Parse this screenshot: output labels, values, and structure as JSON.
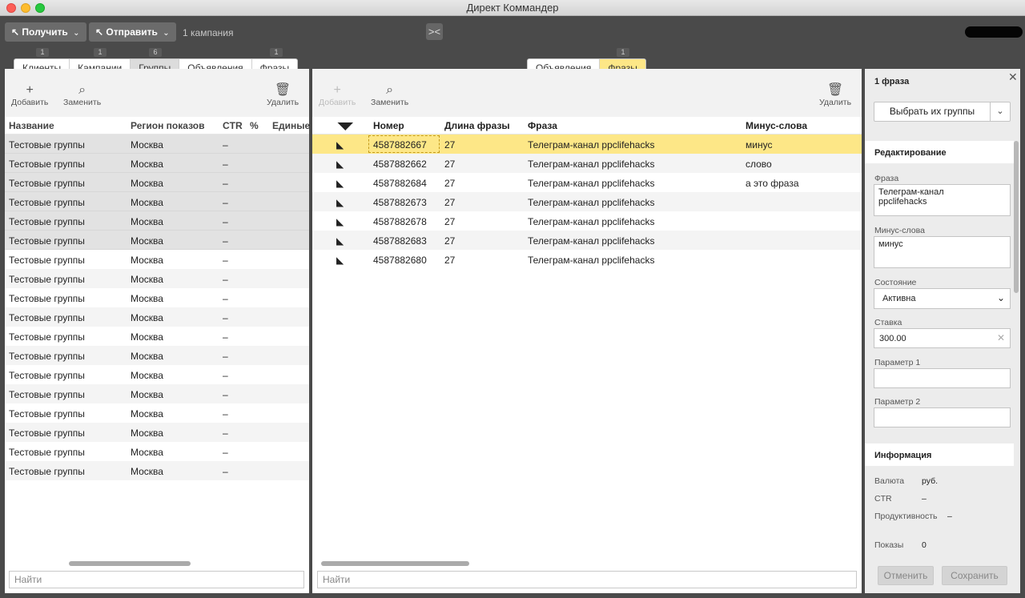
{
  "window": {
    "title": "Директ Коммандер"
  },
  "toolbar": {
    "get_label": "Получить",
    "send_label": "Отправить",
    "campaign_count": "1 кампания",
    "swap_symbol": "><"
  },
  "left": {
    "tabs": [
      {
        "label": "Клиенты",
        "count": "1"
      },
      {
        "label": "Кампании",
        "count": "1"
      },
      {
        "label": "Группы",
        "count": "6"
      },
      {
        "label": "Объявления",
        "count": ""
      },
      {
        "label": "Фразы",
        "count": "1"
      }
    ],
    "actions": {
      "add": "Добавить",
      "replace": "Заменить",
      "delete": "Удалить"
    },
    "columns": [
      "Название",
      "Регион показов",
      "CTR",
      "%",
      "Единые"
    ],
    "rows": [
      {
        "name": "Тестовые группы",
        "region": "Москва",
        "ctr": "–"
      },
      {
        "name": "Тестовые группы",
        "region": "Москва",
        "ctr": "–"
      },
      {
        "name": "Тестовые группы",
        "region": "Москва",
        "ctr": "–"
      },
      {
        "name": "Тестовые группы",
        "region": "Москва",
        "ctr": "–"
      },
      {
        "name": "Тестовые группы",
        "region": "Москва",
        "ctr": "–"
      },
      {
        "name": "Тестовые группы",
        "region": "Москва",
        "ctr": "–"
      },
      {
        "name": "Тестовые группы",
        "region": "Москва",
        "ctr": "–"
      },
      {
        "name": "Тестовые группы",
        "region": "Москва",
        "ctr": "–"
      },
      {
        "name": "Тестовые группы",
        "region": "Москва",
        "ctr": "–"
      },
      {
        "name": "Тестовые группы",
        "region": "Москва",
        "ctr": "–"
      },
      {
        "name": "Тестовые группы",
        "region": "Москва",
        "ctr": "–"
      },
      {
        "name": "Тестовые группы",
        "region": "Москва",
        "ctr": "–"
      },
      {
        "name": "Тестовые группы",
        "region": "Москва",
        "ctr": "–"
      },
      {
        "name": "Тестовые группы",
        "region": "Москва",
        "ctr": "–"
      },
      {
        "name": "Тестовые группы",
        "region": "Москва",
        "ctr": "–"
      },
      {
        "name": "Тестовые группы",
        "region": "Москва",
        "ctr": "–"
      },
      {
        "name": "Тестовые группы",
        "region": "Москва",
        "ctr": "–"
      },
      {
        "name": "Тестовые группы",
        "region": "Москва",
        "ctr": "–"
      }
    ],
    "search_placeholder": "Найти"
  },
  "mid": {
    "tabs": [
      {
        "label": "Объявления",
        "count": ""
      },
      {
        "label": "Фразы",
        "count": "1"
      }
    ],
    "actions": {
      "add": "Добавить",
      "replace": "Заменить",
      "delete": "Удалить"
    },
    "columns": [
      "Номер",
      "Длина фразы",
      "Фраза",
      "Минус-слова"
    ],
    "rows": [
      {
        "id": "4587882667",
        "len": "27",
        "phrase": "Телеграм-канал ppclifehacks",
        "minus": "минус"
      },
      {
        "id": "4587882662",
        "len": "27",
        "phrase": "Телеграм-канал ppclifehacks",
        "minus": "слово"
      },
      {
        "id": "4587882684",
        "len": "27",
        "phrase": "Телеграм-канал ppclifehacks",
        "minus": "а это фраза"
      },
      {
        "id": "4587882673",
        "len": "27",
        "phrase": "Телеграм-канал ppclifehacks",
        "minus": ""
      },
      {
        "id": "4587882678",
        "len": "27",
        "phrase": "Телеграм-канал ppclifehacks",
        "minus": ""
      },
      {
        "id": "4587882683",
        "len": "27",
        "phrase": "Телеграм-канал ppclifehacks",
        "minus": ""
      },
      {
        "id": "4587882680",
        "len": "27",
        "phrase": "Телеграм-канал ppclifehacks",
        "minus": ""
      }
    ],
    "search_placeholder": "Найти"
  },
  "right": {
    "title": "1 фраза",
    "select_group_label": "Выбрать их группы",
    "editing": {
      "section_title": "Редактирование",
      "phrase_label": "Фраза",
      "phrase_value": "Телеграм-канал\nppclifehacks",
      "minus_label": "Минус-слова",
      "minus_value": "минус",
      "state_label": "Состояние",
      "state_value": "Активна",
      "bid_label": "Ставка",
      "bid_value": "300.00",
      "param1_label": "Параметр 1",
      "param2_label": "Параметр 2"
    },
    "info": {
      "section_title": "Информация",
      "currency_label": "Валюта",
      "currency_value": "руб.",
      "ctr_label": "CTR",
      "ctr_value": "–",
      "productivity_label": "Продуктивность",
      "productivity_value": "–",
      "impressions_label": "Показы",
      "impressions_value": "0"
    },
    "cancel_label": "Отменить",
    "save_label": "Сохранить"
  }
}
